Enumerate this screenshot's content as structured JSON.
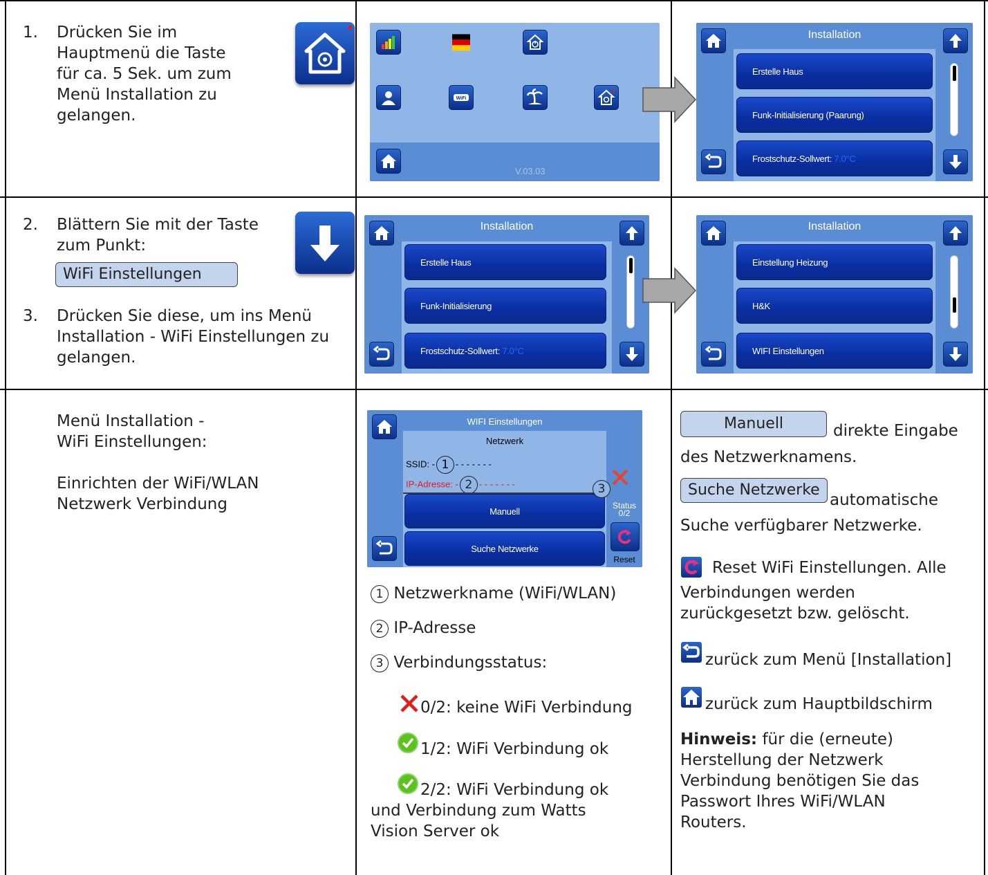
{
  "row1": {
    "step_num": "1.",
    "step_text": [
      "Drücken Sie im",
      "Hauptmenü die Taste",
      "für ca. 5 Sek. um zum",
      "Menü Installation zu gelangen."
    ],
    "main_screen_version": "V.03.03",
    "install_title": "Installation",
    "install_items": [
      "Erstelle Haus",
      "Funk-Initialisierung (Paarung)",
      "Frostschutz-Sollwert:"
    ],
    "frost_value": "7.0°C"
  },
  "row2": {
    "step2_num": "2.",
    "step2_text": [
      "Blättern Sie mit der Taste",
      "zum Punkt:"
    ],
    "step2_pill": "WiFi Einstellungen",
    "step3_num": "3.",
    "step3_text": [
      "Drücken Sie diese, um ins Menü",
      "Installation - WiFi Einstellungen zu",
      "gelangen."
    ],
    "screen_a_title": "Installation",
    "screen_a_items": [
      "Erstelle Haus",
      "Funk-Initialisierung",
      "Frostschutz-Sollwert:"
    ],
    "screen_a_frost_value": "7.0°C",
    "screen_b_title": "Installation",
    "screen_b_items": [
      "Einstellung Heizung",
      "H&K",
      "WIFI Einstellungen"
    ]
  },
  "row3": {
    "left_text": [
      "Menü Installation -",
      "WiFi Einstellungen:"
    ],
    "left_text2": [
      "Einrichten der WiFi/WLAN",
      "Netzwerk Verbindung"
    ],
    "wifi_title": "WIFI Einstellungen",
    "wifi_network": "Netzwerk",
    "wifi_ssid": "SSID: -",
    "wifi_ssid_dashes": "- - - - - - -",
    "wifi_ip": "IP-Adresse: -",
    "wifi_ip_dashes": "- - - - - - -",
    "wifi_manual": "Manuell",
    "wifi_search": "Suche Netzwerke",
    "wifi_status": "Status",
    "wifi_status_val": "0/2",
    "wifi_reset": "Reset",
    "marker1": "1",
    "marker2": "2",
    "marker3": "3",
    "legend1": "Netzwerkname (WiFi/WLAN)",
    "legend2": "IP-Adresse",
    "legend3": "Verbindungsstatus:",
    "status0": "0/2: keine WiFi Verbindung",
    "status1": "1/2: WiFi Verbindung ok",
    "status2": [
      "2/2: WiFi Verbindung ok",
      "und Verbindung zum Watts",
      "Vision Server ok"
    ],
    "right_manual_pill": "Manuell",
    "right_manual_text": "direkte Eingabe",
    "right_manual_text2": "des Netzwerknamens.",
    "right_search_pill": "Suche Netzwerke",
    "right_search_text": "automatische",
    "right_search_text2": "Suche verfügbarer Netzwerke.",
    "right_reset_text": "Reset WiFi Einstellungen. Alle",
    "right_reset_text2": [
      "Verbindungen werden",
      "zurückgesetzt bzw. gelöscht."
    ],
    "right_back_text": "zurück zum Menü [Installation]",
    "right_home_text": "zurück zum Hauptbildschirm",
    "right_hint_bold": "Hinweis:",
    "right_hint_text": " für die (erneute)",
    "right_hint_text2": [
      "Herstellung der Netzwerk",
      "Verbindung benötigen Sie das",
      "Passwort Ihres WiFi/WLAN",
      "Routers."
    ]
  },
  "colors": {
    "accent_blue": "#0a2ea1",
    "panel_blue": "#90b6e7",
    "side_blue": "#5b8dd4",
    "red": "#e51a1a",
    "green": "#5cc21e",
    "frost_blue": "#1e6bff"
  }
}
